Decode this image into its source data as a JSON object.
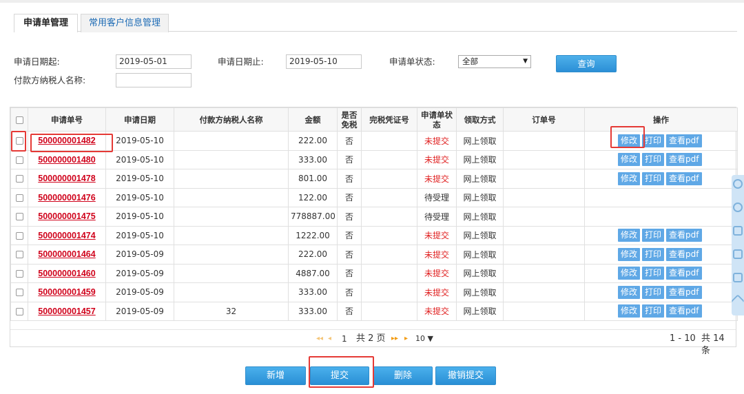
{
  "tabs": [
    {
      "label": "申请单管理",
      "active": true
    },
    {
      "label": "常用客户信息管理",
      "active": false
    }
  ],
  "filters": {
    "date_from_label": "申请日期起:",
    "date_from_value": "2019-05-01",
    "date_to_label": "申请日期止:",
    "date_to_value": "2019-05-10",
    "status_label": "申请单状态:",
    "status_value": "全部",
    "payer_label": "付款方纳税人名称:",
    "payer_value": "",
    "query_button": "查询"
  },
  "table": {
    "headers": {
      "no": "申请单号",
      "date": "申请日期",
      "payer": "付款方纳税人名称",
      "amount": "金额",
      "tax_free_1": "是否",
      "tax_free_2": "免税",
      "voucher": "完税凭证号",
      "status_1": "申请单状",
      "status_2": "态",
      "pickup": "领取方式",
      "order": "订单号",
      "ops": "操作"
    },
    "rows": [
      {
        "no": "500000001482",
        "date": "2019-05-10",
        "payer": "",
        "amount": "222.00",
        "tax_free": "否",
        "status": "未提交",
        "status_color": "#e02020",
        "pickup": "网上领取",
        "ops": [
          "修改",
          "打印",
          "查看pdf"
        ]
      },
      {
        "no": "500000001480",
        "date": "2019-05-10",
        "payer": "",
        "amount": "333.00",
        "tax_free": "否",
        "status": "未提交",
        "status_color": "#e02020",
        "pickup": "网上领取",
        "ops": [
          "修改",
          "打印",
          "查看pdf"
        ]
      },
      {
        "no": "500000001478",
        "date": "2019-05-10",
        "payer": "",
        "amount": "801.00",
        "tax_free": "否",
        "status": "未提交",
        "status_color": "#e02020",
        "pickup": "网上领取",
        "ops": [
          "修改",
          "打印",
          "查看pdf"
        ]
      },
      {
        "no": "500000001476",
        "date": "2019-05-10",
        "payer": "",
        "amount": "122.00",
        "tax_free": "否",
        "status": "待受理",
        "status_color": "#333333",
        "pickup": "网上领取",
        "ops": []
      },
      {
        "no": "500000001475",
        "date": "2019-05-10",
        "payer": "",
        "amount": "778887.00",
        "tax_free": "否",
        "status": "待受理",
        "status_color": "#333333",
        "pickup": "网上领取",
        "ops": []
      },
      {
        "no": "500000001474",
        "date": "2019-05-10",
        "payer": "",
        "amount": "1222.00",
        "tax_free": "否",
        "status": "未提交",
        "status_color": "#e02020",
        "pickup": "网上领取",
        "ops": [
          "修改",
          "打印",
          "查看pdf"
        ]
      },
      {
        "no": "500000001464",
        "date": "2019-05-09",
        "payer": "",
        "amount": "222.00",
        "tax_free": "否",
        "status": "未提交",
        "status_color": "#e02020",
        "pickup": "网上领取",
        "ops": [
          "修改",
          "打印",
          "查看pdf"
        ]
      },
      {
        "no": "500000001460",
        "date": "2019-05-09",
        "payer": "",
        "amount": "4887.00",
        "tax_free": "否",
        "status": "未提交",
        "status_color": "#e02020",
        "pickup": "网上领取",
        "ops": [
          "修改",
          "打印",
          "查看pdf"
        ]
      },
      {
        "no": "500000001459",
        "date": "2019-05-09",
        "payer": "",
        "amount": "333.00",
        "tax_free": "否",
        "status": "未提交",
        "status_color": "#e02020",
        "pickup": "网上领取",
        "ops": [
          "修改",
          "打印",
          "查看pdf"
        ]
      },
      {
        "no": "500000001457",
        "date": "2019-05-09",
        "payer": "32",
        "amount": "333.00",
        "tax_free": "否",
        "status": "未提交",
        "status_color": "#e02020",
        "pickup": "网上领取",
        "ops": [
          "修改",
          "打印",
          "查看pdf"
        ]
      }
    ]
  },
  "pager": {
    "current_page": "1",
    "total_pages": "共 2 页",
    "page_size": "10",
    "range": "1 - 10",
    "total": "共 14 条"
  },
  "actions": {
    "add": "新增",
    "submit": "提交",
    "delete": "删除",
    "revoke": "撤销提交"
  },
  "colors": {
    "primary_button": "#2b8fd6",
    "op_button": "#5fa8e6",
    "order_link": "#d0021b",
    "unsubmitted_status": "#e02020",
    "highlight": "#e53935"
  },
  "icons": {
    "side_tools": [
      "check-circle-icon",
      "chart-icon",
      "document-icon",
      "export-icon",
      "list-icon",
      "collapse-icon"
    ]
  }
}
